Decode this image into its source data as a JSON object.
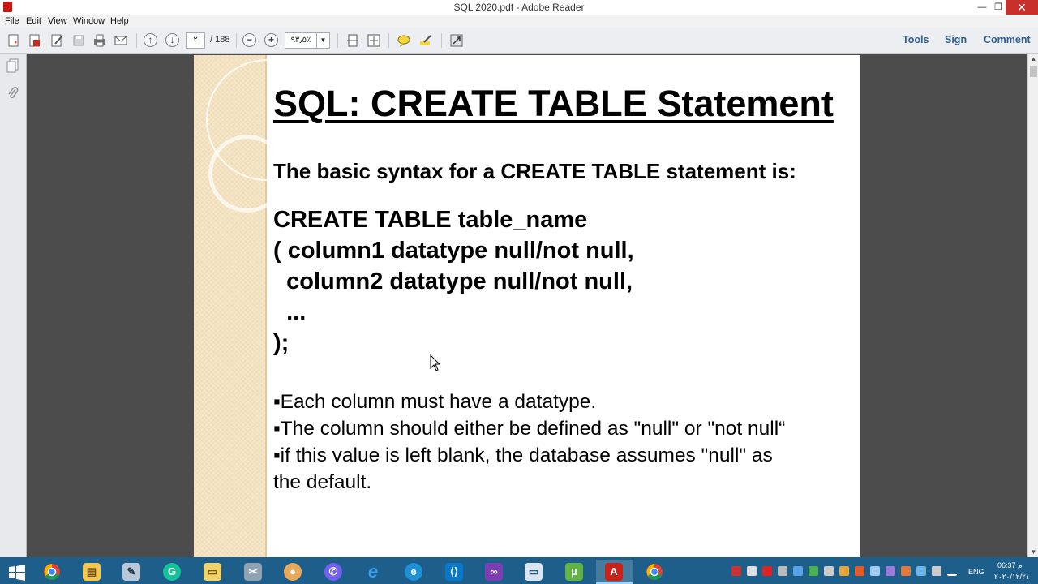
{
  "window": {
    "title": "SQL 2020.pdf - Adobe Reader",
    "minimize": "—",
    "maximize": "❐",
    "close": "✕"
  },
  "menu": {
    "file": "File",
    "edit": "Edit",
    "view": "View",
    "window": "Window",
    "help": "Help"
  },
  "toolbar": {
    "page_current": "۲",
    "page_total": "/ 188",
    "zoom": "۹۳٫۵٪",
    "tools": "Tools",
    "sign": "Sign",
    "comment": "Comment"
  },
  "slide": {
    "title": "SQL: CREATE TABLE Statement",
    "subtitle": "The basic syntax for a CREATE TABLE statement is:",
    "code": [
      "CREATE TABLE table_name",
      "( column1 datatype null/not null,",
      "  column2 datatype null/not null,",
      "  ...",
      ");"
    ],
    "bullets": [
      "▪Each column must have a datatype.",
      "▪The column should either be defined as \"null\" or \"not null“",
      "▪if this value is left blank, the database assumes \"null\" as",
      "the default."
    ]
  },
  "taskbar": {
    "apps": [
      "windows-start",
      "chrome",
      "file-explorer",
      "paint-tool",
      "grammarly",
      "folder",
      "tools",
      "paint",
      "viber",
      "internet-explorer",
      "edge",
      "vscode",
      "visual-studio",
      "window",
      "utorrent",
      "adobe-reader",
      "chrome-2"
    ],
    "active": "adobe-reader",
    "language": "ENG",
    "time": "06:37 م",
    "date": "۲۰۲۰/۱۲/۲۱"
  },
  "colors": {
    "taskbar": "#1d5f8a",
    "toolbar": "#eceef1",
    "doc_background": "#4c4c4c",
    "accent_links": "#2d5f94",
    "close_button": "#c7302b"
  }
}
